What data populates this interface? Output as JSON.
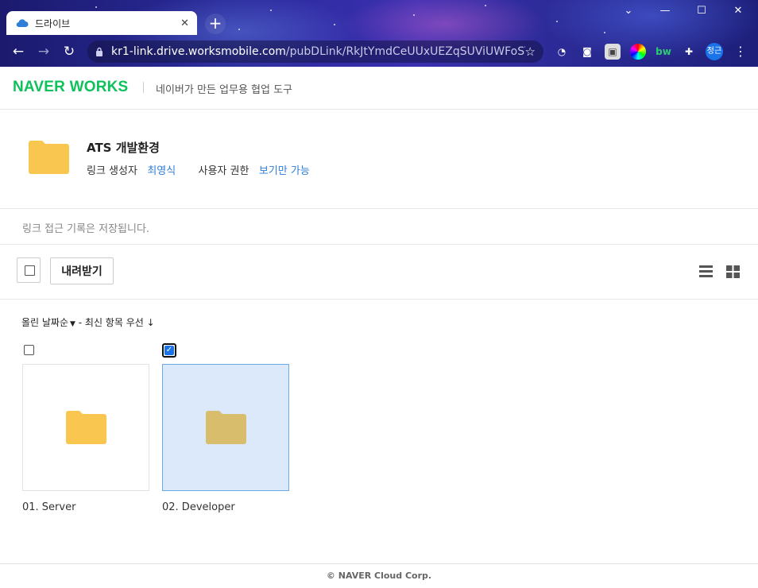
{
  "browser": {
    "tab_title": "드라이브",
    "url_host": "kr1-link.drive.worksmobile.com",
    "url_path": "/pubDLink/RkJtYmdCeUUxUEZqSUViUWFoSTh...",
    "profile_label": "정근",
    "ext_label": "bw"
  },
  "header": {
    "logo": "NAVER WORKS",
    "tagline": "네이버가 만든 업무용 협업 도구"
  },
  "folder_info": {
    "name": "ATS 개발환경",
    "creator_label": "링크 생성자",
    "creator_name": "최영식",
    "permission_label": "사용자 권한",
    "permission_value": "보기만 가능"
  },
  "notice": "링크 접근 기록은 저장됩니다.",
  "actions": {
    "download_label": "내려받기"
  },
  "sort": {
    "sort_label": "올린 날짜순",
    "order_label": "- 최신 항목 우선",
    "order_arrow": "↓"
  },
  "items": [
    {
      "label": "01. Server",
      "checked": false
    },
    {
      "label": "02. Developer",
      "checked": true
    }
  ],
  "footer": "© NAVER Cloud Corp.",
  "colors": {
    "brand_green": "#0ec15b",
    "link_blue": "#2e7dd6",
    "folder_yellow": "#f9c74f",
    "selected_bg": "#dbe9fb"
  }
}
